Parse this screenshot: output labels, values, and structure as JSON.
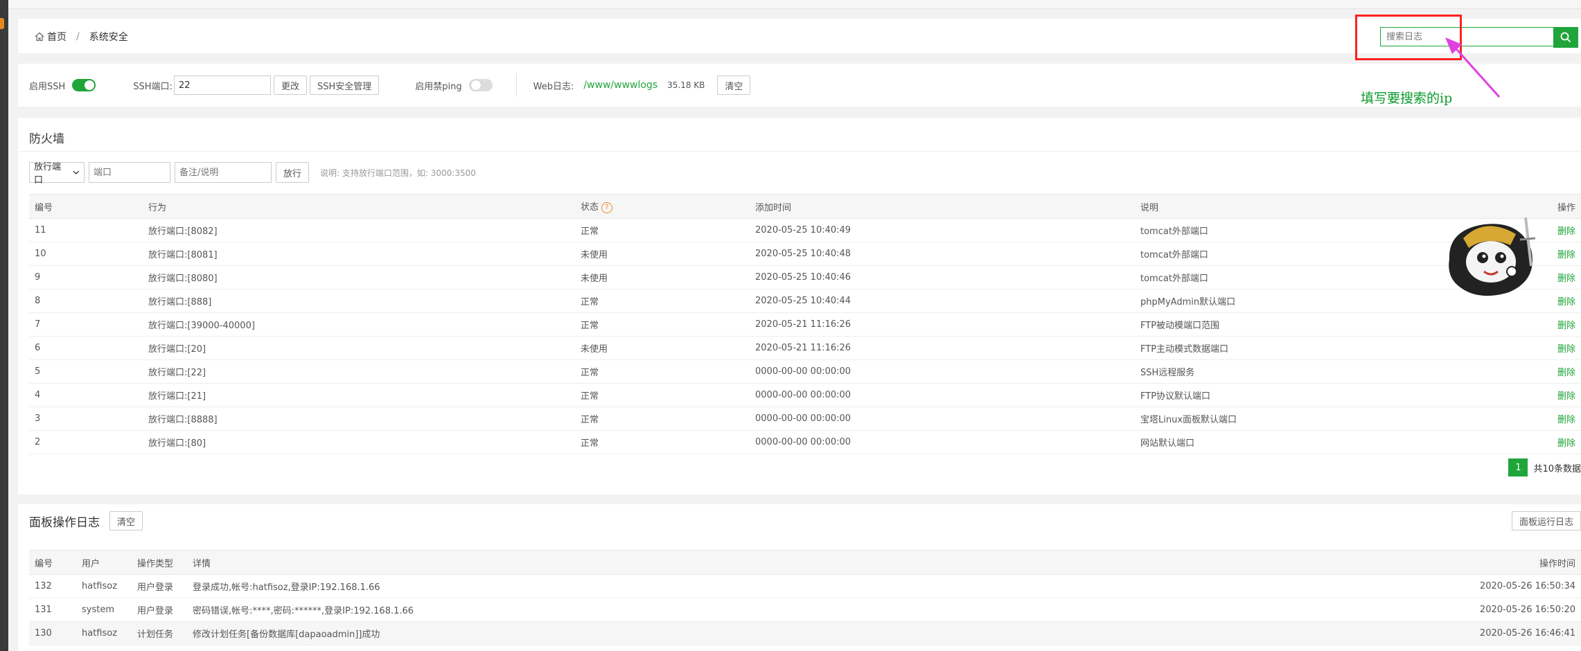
{
  "breadcrumb": {
    "home": "首页",
    "separator": "/",
    "current": "系统安全"
  },
  "search": {
    "placeholder": "搜索日志",
    "icon": "search-icon"
  },
  "settings": {
    "ssh_label": "启用SSH",
    "ssh_enabled": true,
    "ssh_port_label": "SSH端口:",
    "ssh_port_value": "22",
    "change_button": "更改",
    "ssh_manage_button": "SSH安全管理",
    "ping_label": "启用禁ping",
    "ping_enabled": false,
    "web_log_label": "Web日志:",
    "web_log_path": "/www/wwwlogs",
    "web_log_size": "35.18 KB",
    "clear_button": "清空"
  },
  "firewall": {
    "title": "防火墙",
    "select_value": "放行端口",
    "port_placeholder": "端口",
    "note_placeholder": "备注/说明",
    "add_button": "放行",
    "hint": "说明: 支持放行端口范围，如: 3000:3500",
    "columns": [
      "编号",
      "行为",
      "状态",
      "添加时间",
      "说明",
      "操作"
    ],
    "status_help": "?",
    "rows": [
      {
        "id": "11",
        "action": "放行端口:[8082]",
        "status": "正常",
        "time": "2020-05-25 10:40:49",
        "note": "tomcat外部端口",
        "op": "删除"
      },
      {
        "id": "10",
        "action": "放行端口:[8081]",
        "status": "未使用",
        "time": "2020-05-25 10:40:48",
        "note": "tomcat外部端口",
        "op": "删除"
      },
      {
        "id": "9",
        "action": "放行端口:[8080]",
        "status": "未使用",
        "time": "2020-05-25 10:40:46",
        "note": "tomcat外部端口",
        "op": "删除"
      },
      {
        "id": "8",
        "action": "放行端口:[888]",
        "status": "正常",
        "time": "2020-05-25 10:40:44",
        "note": "phpMyAdmin默认端口",
        "op": "删除"
      },
      {
        "id": "7",
        "action": "放行端口:[39000-40000]",
        "status": "正常",
        "time": "2020-05-21 11:16:26",
        "note": "FTP被动模端口范围",
        "op": "删除"
      },
      {
        "id": "6",
        "action": "放行端口:[20]",
        "status": "未使用",
        "time": "2020-05-21 11:16:26",
        "note": "FTP主动模式数据端口",
        "op": "删除"
      },
      {
        "id": "5",
        "action": "放行端口:[22]",
        "status": "正常",
        "time": "0000-00-00 00:00:00",
        "note": "SSH远程服务",
        "op": "删除"
      },
      {
        "id": "4",
        "action": "放行端口:[21]",
        "status": "正常",
        "time": "0000-00-00 00:00:00",
        "note": "FTP协议默认端口",
        "op": "删除"
      },
      {
        "id": "3",
        "action": "放行端口:[8888]",
        "status": "正常",
        "time": "0000-00-00 00:00:00",
        "note": "宝塔Linux面板默认端口",
        "op": "删除"
      },
      {
        "id": "2",
        "action": "放行端口:[80]",
        "status": "正常",
        "time": "0000-00-00 00:00:00",
        "note": "网站默认端口",
        "op": "删除"
      }
    ],
    "page_current": "1",
    "page_total": "共10条数据"
  },
  "logs": {
    "title": "面板操作日志",
    "clear_button": "清空",
    "run_log_button": "面板运行日志",
    "columns": [
      "编号",
      "用户",
      "操作类型",
      "详情",
      "操作时间"
    ],
    "rows": [
      {
        "id": "132",
        "user": "hatfisoz",
        "type": "用户登录",
        "detail": "登录成功,帐号:hatfisoz,登录IP:192.168.1.66",
        "time": "2020-05-26 16:50:34"
      },
      {
        "id": "131",
        "user": "system",
        "type": "用户登录",
        "detail": "密码错误,帐号:****,密码:******,登录IP:192.168.1.66",
        "time": "2020-05-26 16:50:20"
      },
      {
        "id": "130",
        "user": "hatfisoz",
        "type": "计划任务",
        "detail": "修改计划任务[备份数据库[dapaoadmin]]成功",
        "time": "2020-05-26 16:46:41"
      }
    ]
  },
  "annotation": {
    "text": "填写要搜索的ip"
  },
  "colors": {
    "accent": "#20a53a",
    "annotation_red": "#ff2020",
    "arrow": "#e040e0"
  }
}
